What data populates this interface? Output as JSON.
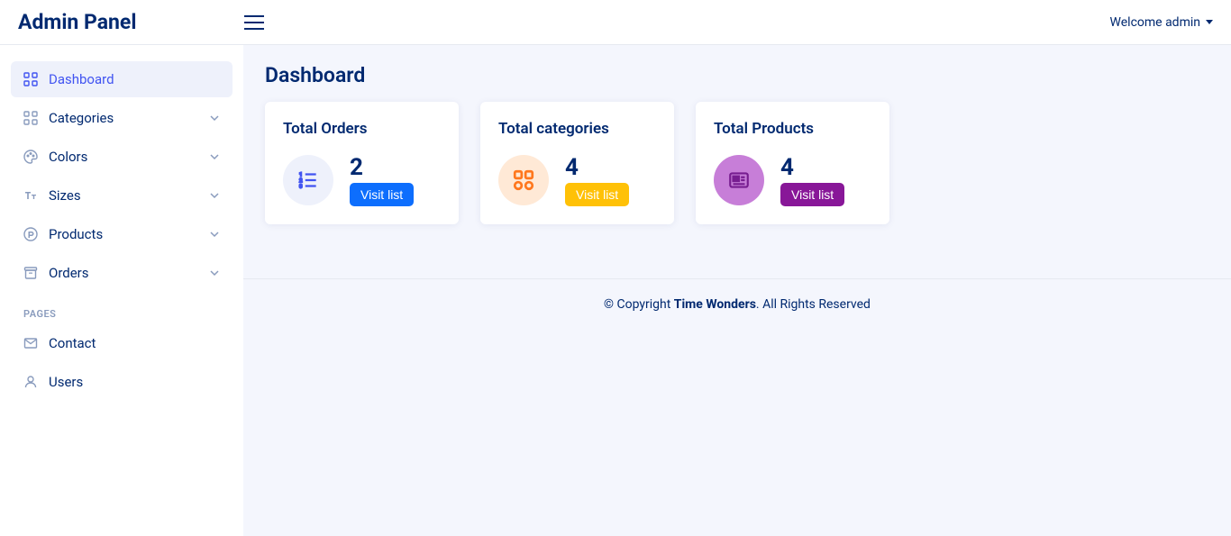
{
  "header": {
    "brand": "Admin Panel",
    "welcome": "Welcome admin"
  },
  "sidebar": {
    "items": [
      {
        "label": "Dashboard"
      },
      {
        "label": "Categories"
      },
      {
        "label": "Colors"
      },
      {
        "label": "Sizes"
      },
      {
        "label": "Products"
      },
      {
        "label": "Orders"
      }
    ],
    "section_label": "PAGES",
    "pages": [
      {
        "label": "Contact"
      },
      {
        "label": "Users"
      }
    ]
  },
  "main": {
    "title": "Dashboard",
    "cards": [
      {
        "title": "Total Orders",
        "value": "2",
        "button": "Visit list"
      },
      {
        "title": "Total categories",
        "value": "4",
        "button": "Visit list"
      },
      {
        "title": "Total Products",
        "value": "4",
        "button": "Visit list"
      }
    ]
  },
  "footer": {
    "prefix": "© Copyright ",
    "brand": "Time Wonders",
    "suffix": ". All Rights Reserved"
  }
}
